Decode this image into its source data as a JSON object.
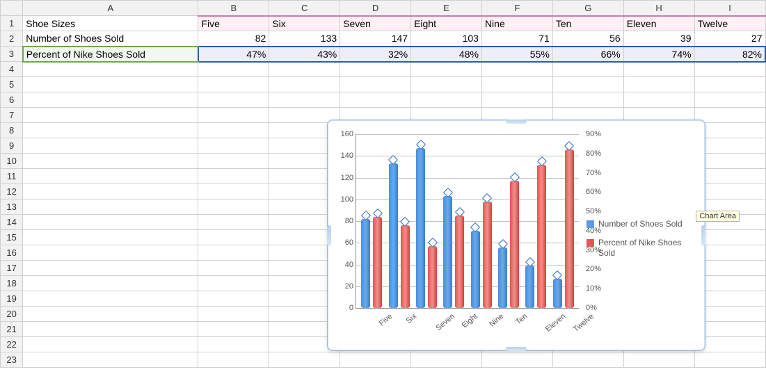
{
  "columns": [
    "A",
    "B",
    "C",
    "D",
    "E",
    "F",
    "G",
    "H",
    "I"
  ],
  "row_headers": [
    1,
    2,
    3,
    4,
    5,
    6,
    7,
    8,
    9,
    10,
    11,
    12,
    13,
    14,
    15,
    16,
    17,
    18,
    19,
    20,
    21,
    22,
    23
  ],
  "table": {
    "r1_label": "Shoe Sizes",
    "r2_label": "Number of Shoes Sold",
    "r3_label": "Percent of Nike Shoes Sold",
    "cats": [
      "Five",
      "Six",
      "Seven",
      "Eight",
      "Nine",
      "Ten",
      "Eleven",
      "Twelve"
    ],
    "counts": [
      "82",
      "133",
      "147",
      "103",
      "71",
      "56",
      "39",
      "27"
    ],
    "pcts": [
      "47%",
      "43%",
      "32%",
      "48%",
      "55%",
      "66%",
      "74%",
      "82%"
    ]
  },
  "legend": {
    "s1": "Number of Shoes Sold",
    "s2": "Percent of Nike Shoes Sold"
  },
  "tooltip": "Chart Area",
  "y1_ticks": [
    "160",
    "140",
    "120",
    "100",
    "80",
    "60",
    "40",
    "20",
    "0"
  ],
  "y2_ticks": [
    "90%",
    "80%",
    "70%",
    "60%",
    "50%",
    "40%",
    "30%",
    "20%",
    "10%",
    "0%"
  ],
  "chart_data": {
    "type": "bar",
    "categories": [
      "Five",
      "Six",
      "Seven",
      "Eight",
      "Nine",
      "Ten",
      "Eleven",
      "Twelve"
    ],
    "series": [
      {
        "name": "Number of Shoes Sold",
        "axis": "left",
        "values": [
          82,
          133,
          147,
          103,
          71,
          56,
          39,
          27
        ]
      },
      {
        "name": "Percent of Nike Shoes Sold",
        "axis": "right",
        "values": [
          47,
          43,
          32,
          48,
          55,
          66,
          74,
          82
        ]
      }
    ],
    "y_left": {
      "min": 0,
      "max": 160,
      "step": 20,
      "label": ""
    },
    "y_right": {
      "min": 0,
      "max": 90,
      "step": 10,
      "label": "",
      "format": "percent"
    },
    "title": ""
  }
}
